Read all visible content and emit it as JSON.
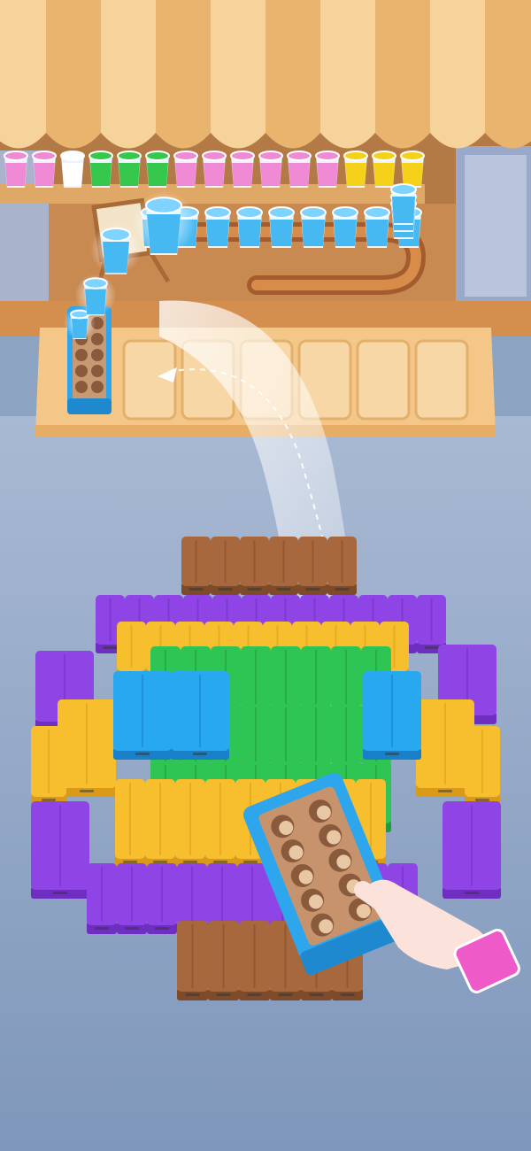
{
  "scene": {
    "description_type": "puzzle-game-screenshot",
    "colors": {
      "floor": "#8ea5c4",
      "awning_light": "#f6d39a",
      "awning_dark": "#e9b46d",
      "wood": "#c98d53",
      "counter": "#f2c27d",
      "purple": "#8f45e6",
      "yellow": "#f7bf2e",
      "green": "#2fc554",
      "blue": "#27a8ef",
      "brown": "#a8683d",
      "pink": "#f36ac8",
      "tray_blue": "#2fa7ef",
      "cup_blue": "#46b9f2"
    }
  },
  "shelf_cups": [
    {
      "color": "#f08ad4"
    },
    {
      "color": "#f08ad4"
    },
    {
      "color": "#ffffff"
    },
    {
      "color": "#35c84d"
    },
    {
      "color": "#35c84d"
    },
    {
      "color": "#35c84d"
    },
    {
      "color": "#f08ad4"
    },
    {
      "color": "#f08ad4"
    },
    {
      "color": "#f08ad4"
    },
    {
      "color": "#f08ad4"
    },
    {
      "color": "#f08ad4"
    },
    {
      "color": "#f08ad4"
    },
    {
      "color": "#f5d11a"
    },
    {
      "color": "#f5d11a"
    },
    {
      "color": "#f5d11a"
    }
  ],
  "conveyor_cups_count": 12,
  "slot_count": 6,
  "tray_cells": 10,
  "hand_icon": "pointing-hand-icon"
}
